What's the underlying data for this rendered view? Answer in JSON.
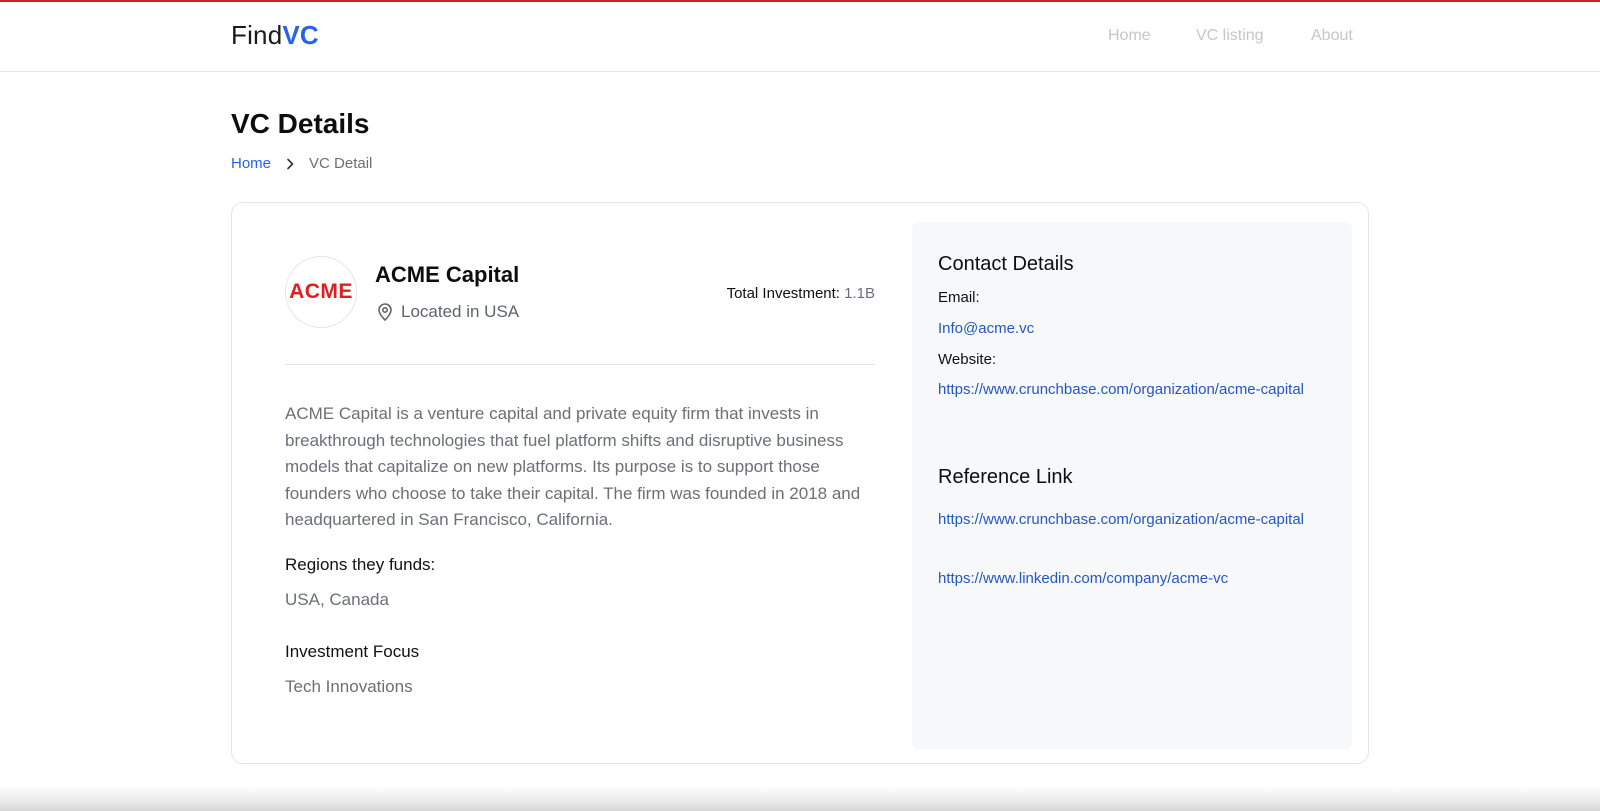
{
  "header": {
    "logo_find": "Find",
    "logo_vc": "VC",
    "nav": [
      "Home",
      "VC listing",
      "About"
    ]
  },
  "page": {
    "title": "VC Details",
    "breadcrumb_home": "Home",
    "breadcrumb_current": "VC Detail"
  },
  "firm": {
    "logo_text": "ACME",
    "name": "ACME Capital",
    "location": "Located in USA",
    "total_investment_label": "Total Investment:",
    "total_investment_value": "1.1B",
    "description": "ACME Capital is a venture capital and private equity firm that invests in breakthrough technologies that fuel platform shifts and disruptive business models that capitalize on new platforms. Its purpose is to support those founders who choose to take their capital. The firm was founded in 2018 and headquartered in San Francisco, California.",
    "regions_label": "Regions they funds:",
    "regions_value": "USA, Canada",
    "focus_label": "Investment Focus",
    "focus_value": "Tech Innovations"
  },
  "contact": {
    "title": "Contact Details",
    "email_label": "Email:",
    "email": "Info@acme.vc",
    "website_label": "Website:",
    "website": "https://www.crunchbase.com/organization/acme-capital"
  },
  "reference": {
    "title": "Reference Link",
    "links": [
      "https://www.crunchbase.com/organization/acme-capital",
      "https://www.linkedin.com/company/acme-vc"
    ]
  },
  "colors": {
    "accent": "#2563eb",
    "brand_red": "#e11d21",
    "top_bar": "#c62828"
  },
  "icons": {
    "breadcrumb_separator": "chevron-right-icon",
    "location": "map-pin-icon"
  }
}
